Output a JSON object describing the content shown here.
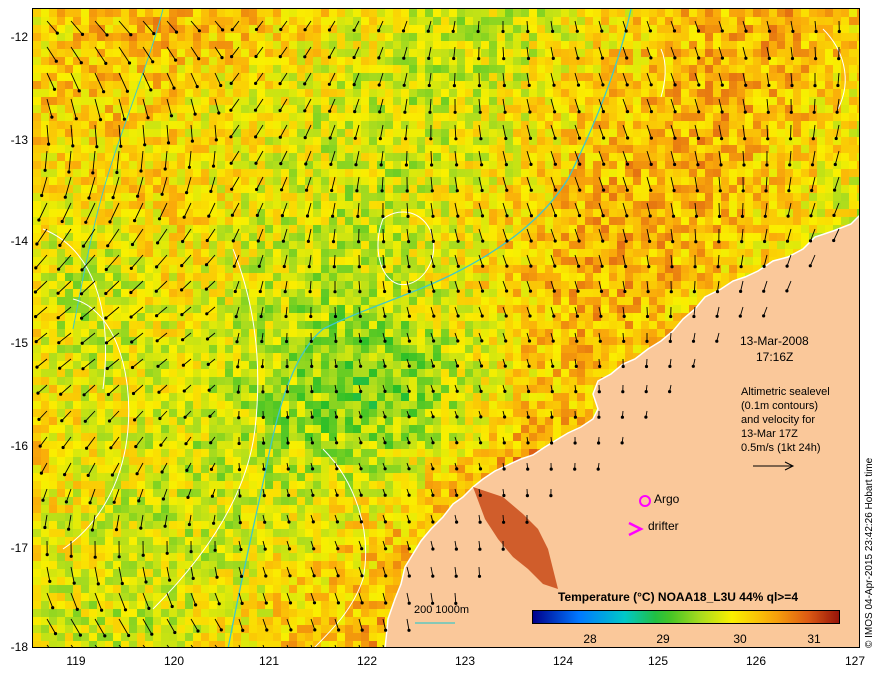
{
  "axes": {
    "lat_ticks": [
      "-12",
      "-13",
      "-14",
      "-15",
      "-16",
      "-17",
      "-18"
    ],
    "lon_ticks": [
      "119",
      "120",
      "121",
      "122",
      "123",
      "124",
      "125",
      "126",
      "127"
    ],
    "lon_range": [
      118.6,
      127
    ],
    "lat_range": [
      -11.7,
      -18
    ]
  },
  "annotation": {
    "date": "13-Mar-2008",
    "time": "17:16Z",
    "legend_lines": [
      "Altimetric sealevel",
      "(0.1m contours)",
      "and velocity for",
      "13-Mar 17Z",
      "0.5m/s (1kt 24h)"
    ],
    "argo_label": "Argo",
    "drifter_label": "drifter",
    "depth_label": "200  1000m",
    "credit": "© IMOS 04-Apr-2015 23:42:26 Hobart time"
  },
  "colorbar": {
    "title": "Temperature (°C) NOAA18_L3U 44% ql>=4",
    "ticks": [
      "28",
      "29",
      "30",
      "31"
    ],
    "range": [
      27.3,
      31.6
    ]
  },
  "colors": {
    "land": "#fac89a",
    "coast": "#ffffff",
    "bathymetry": "#40c8c8",
    "contour": "#ffffff",
    "argo": "#ff00ff",
    "drifter": "#ff00ff",
    "arrows": "#000000"
  }
}
